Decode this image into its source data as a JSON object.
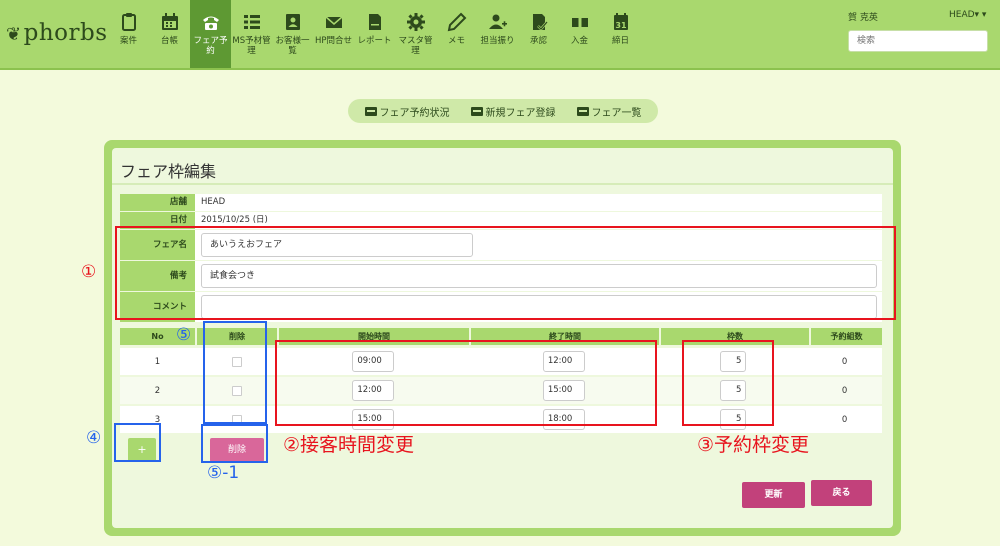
{
  "brand": {
    "logo_text": "phorbs"
  },
  "nav": [
    {
      "label": "案件",
      "icon": "clipboard-icon"
    },
    {
      "label": "台帳",
      "icon": "calendar-icon"
    },
    {
      "label": "フェア予約",
      "icon": "phone-icon",
      "active": true
    },
    {
      "label": "MS予材管理",
      "icon": "list-icon"
    },
    {
      "label": "お客様一覧",
      "icon": "contact-card-icon"
    },
    {
      "label": "HP問合せ",
      "icon": "envelope-icon"
    },
    {
      "label": "レポート",
      "icon": "document-icon"
    },
    {
      "label": "マスタ管理",
      "icon": "gear-icon"
    },
    {
      "label": "メモ",
      "icon": "pencil-icon"
    },
    {
      "label": "担当振り",
      "icon": "user-add-icon"
    },
    {
      "label": "承認",
      "icon": "approve-icon"
    },
    {
      "label": "入金",
      "icon": "money-icon"
    },
    {
      "label": "締日",
      "icon": "calendar-day-icon"
    }
  ],
  "header": {
    "user_name": "賀 克英",
    "user_menu": "HEAD▾  ▾",
    "search_placeholder": "検索"
  },
  "subnav": [
    "フェア予約状況",
    "新規フェア登録",
    "フェア一覧"
  ],
  "panel": {
    "title": "フェア枠編集"
  },
  "info": {
    "store_label": "店舗",
    "store_value": "HEAD",
    "date_label": "日付",
    "date_value": "2015/10/25 (日)",
    "fair_name_label": "フェア名",
    "fair_name_value": "あいうえおフェア",
    "remarks_label": "備考",
    "remarks_value": "試食会つき",
    "comment_label": "コメント",
    "comment_value": ""
  },
  "table": {
    "headers": [
      "No",
      "削除",
      "開始時間",
      "終了時間",
      "枠数",
      "予約組数"
    ],
    "rows": [
      {
        "no": "1",
        "start": "09:00",
        "end": "12:00",
        "slots": "5",
        "reserved": "0"
      },
      {
        "no": "2",
        "start": "12:00",
        "end": "15:00",
        "slots": "5",
        "reserved": "0"
      },
      {
        "no": "3",
        "start": "15:00",
        "end": "18:00",
        "slots": "5",
        "reserved": "0"
      }
    ]
  },
  "buttons": {
    "add": "+",
    "delete": "削除",
    "update": "更新",
    "back": "戻る"
  },
  "annotations": {
    "a1": "①",
    "a2": "②接客時間変更",
    "a3": "③予約枠変更",
    "a4": "④",
    "a5": "⑤",
    "a5_1": "⑤-1",
    "color_red": "#e8141e",
    "color_blue": "#2563eb"
  },
  "colors": {
    "topbar": "#a9d86e",
    "active_nav": "#5e9933",
    "primary_button": "#c2417b",
    "delete_button": "#d9679a",
    "background": "#f3fadc"
  }
}
